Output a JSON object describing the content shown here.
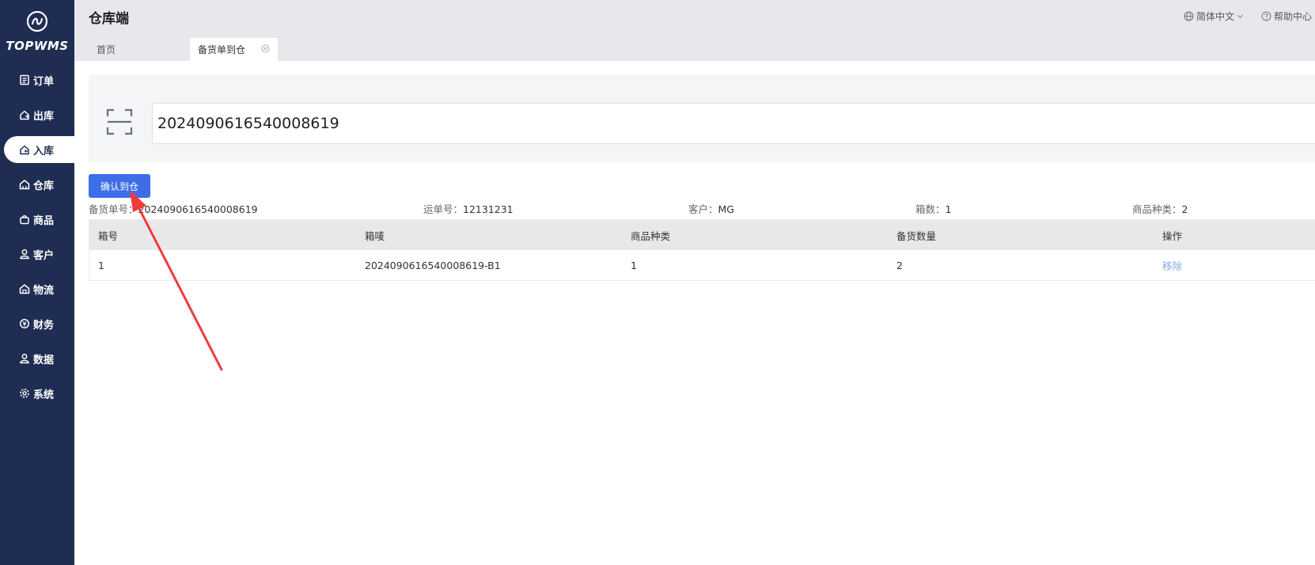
{
  "sidebar": {
    "logo_text": "TOPWMS",
    "items": [
      {
        "label": "订单",
        "icon": "order-icon"
      },
      {
        "label": "出库",
        "icon": "outbound-icon"
      },
      {
        "label": "入库",
        "icon": "inbound-icon",
        "active": true
      },
      {
        "label": "仓库",
        "icon": "warehouse-icon"
      },
      {
        "label": "商品",
        "icon": "product-icon"
      },
      {
        "label": "客户",
        "icon": "customer-icon"
      },
      {
        "label": "物流",
        "icon": "logistics-icon"
      },
      {
        "label": "财务",
        "icon": "finance-icon"
      },
      {
        "label": "数据",
        "icon": "data-icon"
      },
      {
        "label": "系统",
        "icon": "system-icon"
      }
    ]
  },
  "header": {
    "title": "仓库端",
    "language": "简体中文",
    "help": "帮助中心"
  },
  "tabs": {
    "home": "首页",
    "current": "备货单到仓"
  },
  "scan": {
    "value": "2024090616540008619"
  },
  "confirm_button": "确认到仓",
  "info": {
    "order_no_label": "备货单号：",
    "order_no": "2024090616540008619",
    "waybill_label": "运单号：",
    "waybill": "12131231",
    "customer_label": "客户：",
    "customer": "MG",
    "boxes_label": "箱数：",
    "boxes": "1",
    "sku_types_label": "商品种类：",
    "sku_types": "2"
  },
  "table": {
    "columns": [
      "箱号",
      "箱唛",
      "商品种类",
      "备货数量",
      "操作"
    ],
    "rows": [
      {
        "box_no": "1",
        "box_mark": "2024090616540008619-B1",
        "sku_types": "1",
        "quantity": "2",
        "action": "移除"
      }
    ]
  },
  "colors": {
    "sidebar_bg": "#1f2d52",
    "primary": "#3d6ee8",
    "annotation_arrow": "#ef3b3b"
  }
}
